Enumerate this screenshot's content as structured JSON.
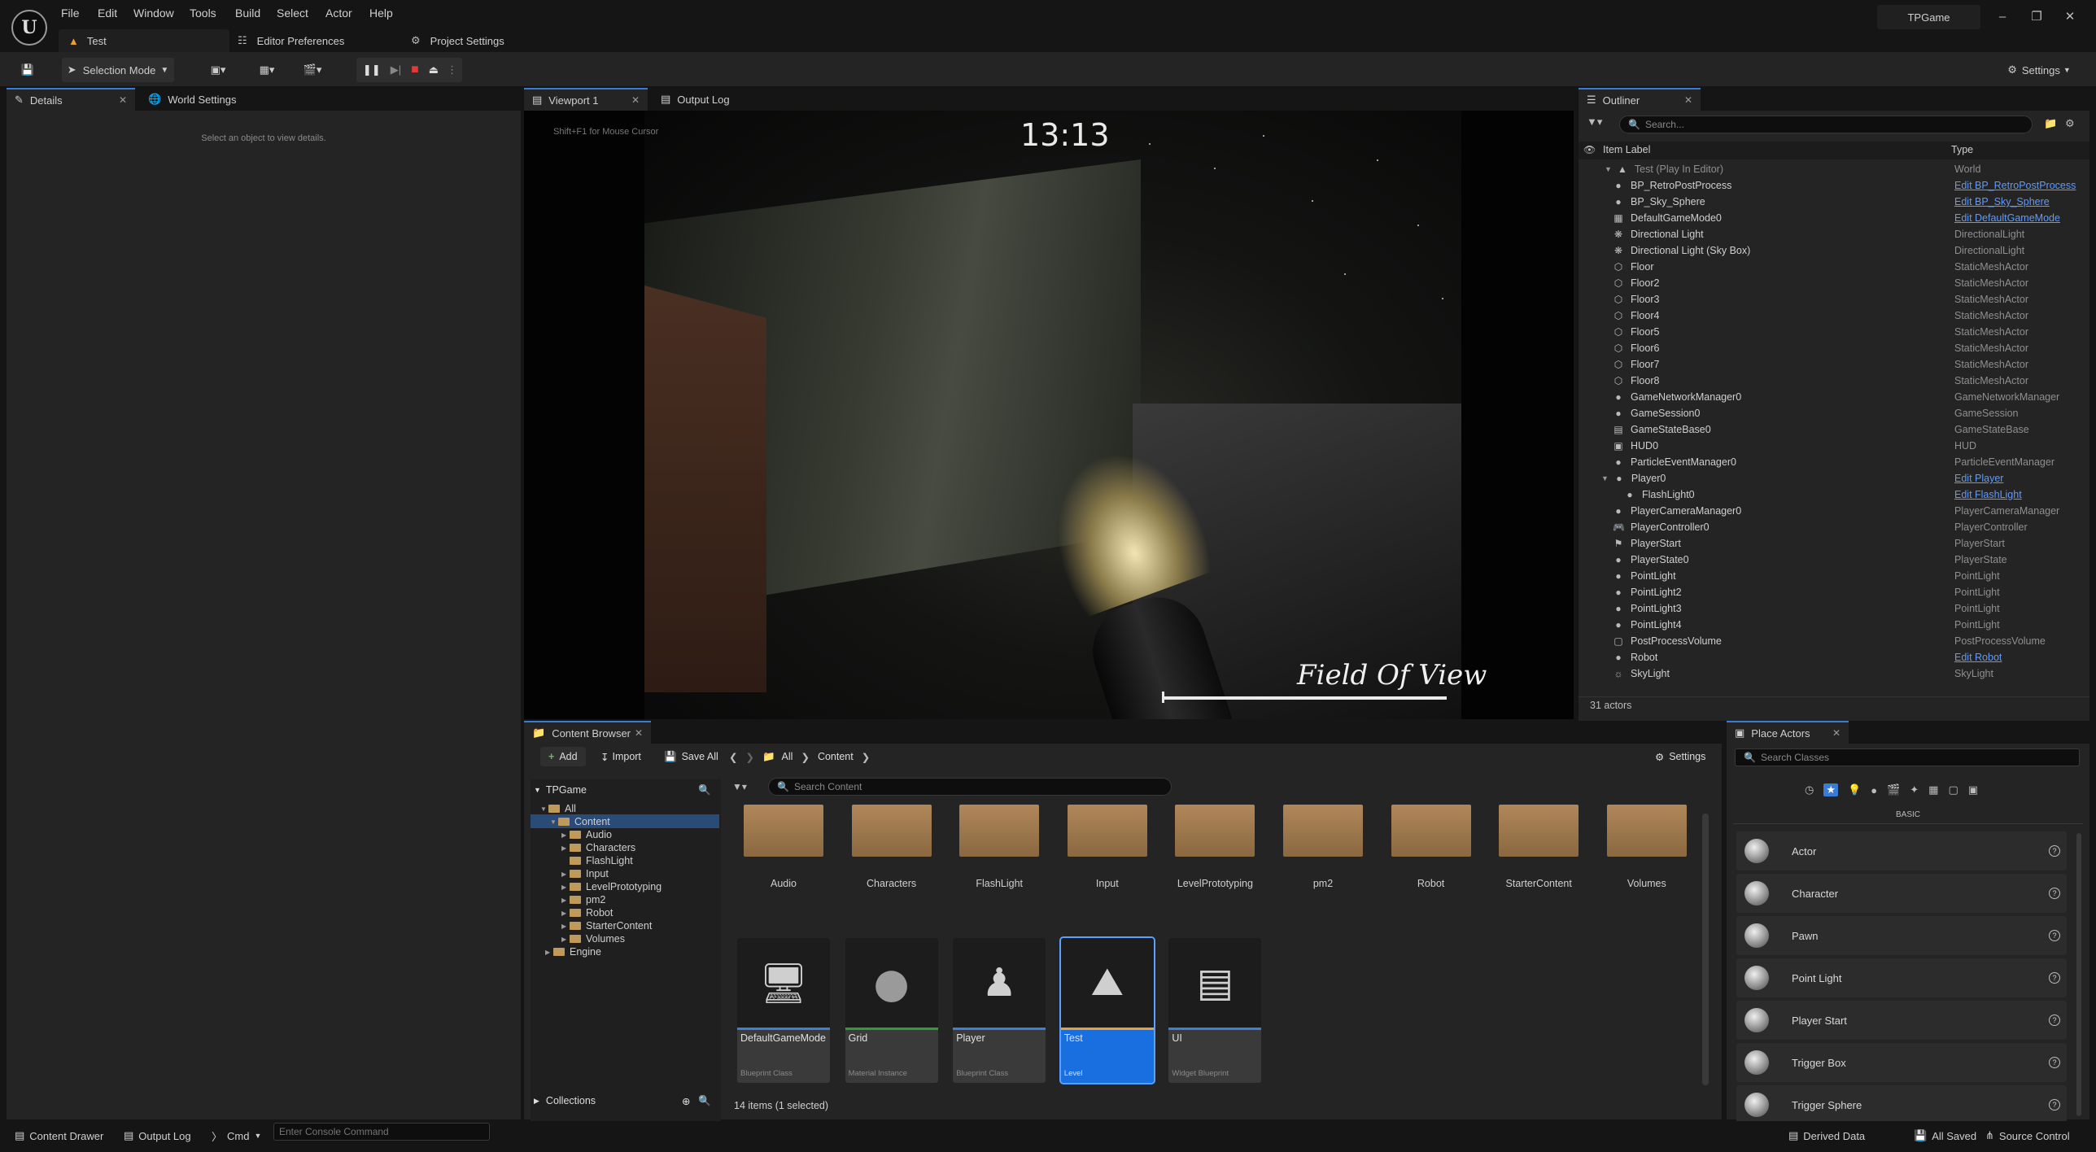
{
  "menu": [
    "File",
    "Edit",
    "Window",
    "Tools",
    "Build",
    "Select",
    "Actor",
    "Help"
  ],
  "project_name": "TPGame",
  "doc_tabs": {
    "level": "Test",
    "editor_prefs": "Editor Preferences",
    "project_settings": "Project Settings"
  },
  "toolbar": {
    "mode": "Selection Mode",
    "settings": "Settings"
  },
  "details": {
    "tab": "Details",
    "tab2": "World Settings",
    "empty_msg": "Select an object to view details."
  },
  "viewport": {
    "tab": "Viewport 1",
    "tab2": "Output Log",
    "hint": "Shift+F1 for Mouse Cursor",
    "clock": "13:13",
    "fov_label": "Field Of View"
  },
  "outliner": {
    "tab": "Outliner",
    "search_placeholder": "Search...",
    "col_label": "Item Label",
    "col_type": "Type",
    "root": {
      "label": "Test (Play In Editor)",
      "type": "World"
    },
    "rows": [
      {
        "label": "BP_RetroPostProcess",
        "type": "Edit BP_RetroPostProcess",
        "link": true,
        "icon": "actor-icon"
      },
      {
        "label": "BP_Sky_Sphere",
        "type": "Edit BP_Sky_Sphere",
        "link": true,
        "icon": "actor-icon"
      },
      {
        "label": "DefaultGameMode0",
        "type": "Edit DefaultGameMode",
        "link": true,
        "icon": "gamemode-icon"
      },
      {
        "label": "Directional Light",
        "type": "DirectionalLight",
        "link": false,
        "icon": "sun-icon"
      },
      {
        "label": "Directional Light (Sky Box)",
        "type": "DirectionalLight",
        "link": false,
        "icon": "sun-icon"
      },
      {
        "label": "Floor",
        "type": "StaticMeshActor",
        "link": false,
        "icon": "mesh-icon"
      },
      {
        "label": "Floor2",
        "type": "StaticMeshActor",
        "link": false,
        "icon": "mesh-icon"
      },
      {
        "label": "Floor3",
        "type": "StaticMeshActor",
        "link": false,
        "icon": "mesh-icon"
      },
      {
        "label": "Floor4",
        "type": "StaticMeshActor",
        "link": false,
        "icon": "mesh-icon"
      },
      {
        "label": "Floor5",
        "type": "StaticMeshActor",
        "link": false,
        "icon": "mesh-icon"
      },
      {
        "label": "Floor6",
        "type": "StaticMeshActor",
        "link": false,
        "icon": "mesh-icon"
      },
      {
        "label": "Floor7",
        "type": "StaticMeshActor",
        "link": false,
        "icon": "mesh-icon"
      },
      {
        "label": "Floor8",
        "type": "StaticMeshActor",
        "link": false,
        "icon": "mesh-icon"
      },
      {
        "label": "GameNetworkManager0",
        "type": "GameNetworkManager",
        "link": false,
        "icon": "actor-icon"
      },
      {
        "label": "GameSession0",
        "type": "GameSession",
        "link": false,
        "icon": "actor-icon"
      },
      {
        "label": "GameStateBase0",
        "type": "GameStateBase",
        "link": false,
        "icon": "gamestate-icon"
      },
      {
        "label": "HUD0",
        "type": "HUD",
        "link": false,
        "icon": "hud-icon"
      },
      {
        "label": "ParticleEventManager0",
        "type": "ParticleEventManager",
        "link": false,
        "icon": "actor-icon"
      },
      {
        "label": "Player0",
        "type": "Edit Player",
        "link": true,
        "icon": "pawn-icon"
      },
      {
        "label": "FlashLight0",
        "type": "Edit FlashLight",
        "link": true,
        "icon": "actor-icon"
      },
      {
        "label": "PlayerCameraManager0",
        "type": "PlayerCameraManager",
        "link": false,
        "icon": "actor-icon"
      },
      {
        "label": "PlayerController0",
        "type": "PlayerController",
        "link": false,
        "icon": "controller-icon"
      },
      {
        "label": "PlayerStart",
        "type": "PlayerStart",
        "link": false,
        "icon": "flag-icon"
      },
      {
        "label": "PlayerState0",
        "type": "PlayerState",
        "link": false,
        "icon": "actor-icon"
      },
      {
        "label": "PointLight",
        "type": "PointLight",
        "link": false,
        "icon": "bulb-icon"
      },
      {
        "label": "PointLight2",
        "type": "PointLight",
        "link": false,
        "icon": "bulb-icon"
      },
      {
        "label": "PointLight3",
        "type": "PointLight",
        "link": false,
        "icon": "bulb-icon"
      },
      {
        "label": "PointLight4",
        "type": "PointLight",
        "link": false,
        "icon": "bulb-icon"
      },
      {
        "label": "PostProcessVolume",
        "type": "PostProcessVolume",
        "link": false,
        "icon": "volume-icon"
      },
      {
        "label": "Robot",
        "type": "Edit Robot",
        "link": true,
        "icon": "pawn-icon"
      },
      {
        "label": "SkyLight",
        "type": "SkyLight",
        "link": false,
        "icon": "skylight-icon"
      }
    ],
    "actor_count": "31 actors"
  },
  "content_browser": {
    "tab": "Content Browser",
    "add": "Add",
    "import": "Import",
    "save_all": "Save All",
    "path": [
      "All",
      "Content"
    ],
    "settings": "Settings",
    "root": "TPGame",
    "search_placeholder": "Search Content",
    "tree": [
      "All",
      "Content",
      "Audio",
      "Characters",
      "FlashLight",
      "Input",
      "LevelPrototyping",
      "pm2",
      "Robot",
      "StarterContent",
      "Volumes",
      "Engine"
    ],
    "collections": "Collections",
    "folders": [
      "Audio",
      "Characters",
      "FlashLight",
      "Input",
      "LevelPrototyping",
      "pm2",
      "Robot",
      "StarterContent",
      "Volumes"
    ],
    "assets": [
      {
        "name": "DefaultGameMode",
        "class": "Blueprint Class",
        "color": "#3c7fd6"
      },
      {
        "name": "Grid",
        "class": "Material Instance",
        "color": "#2f9c3b"
      },
      {
        "name": "Player",
        "class": "Blueprint Class",
        "color": "#3c7fd6"
      },
      {
        "name": "Test",
        "class": "Level",
        "color": "#e8a13a"
      },
      {
        "name": "UI",
        "class": "Widget Blueprint",
        "color": "#3c7fd6"
      }
    ],
    "status": "14 items (1 selected)"
  },
  "place_actors": {
    "tab": "Place Actors",
    "search_placeholder": "Search Classes",
    "category": "BASIC",
    "items": [
      "Actor",
      "Character",
      "Pawn",
      "Point Light",
      "Player Start",
      "Trigger Box",
      "Trigger Sphere"
    ]
  },
  "statusbar": {
    "content_drawer": "Content Drawer",
    "output_log": "Output Log",
    "cmd": "Cmd",
    "console_placeholder": "Enter Console Command",
    "derived_data": "Derived Data",
    "all_saved": "All Saved",
    "source_control": "Source Control"
  }
}
